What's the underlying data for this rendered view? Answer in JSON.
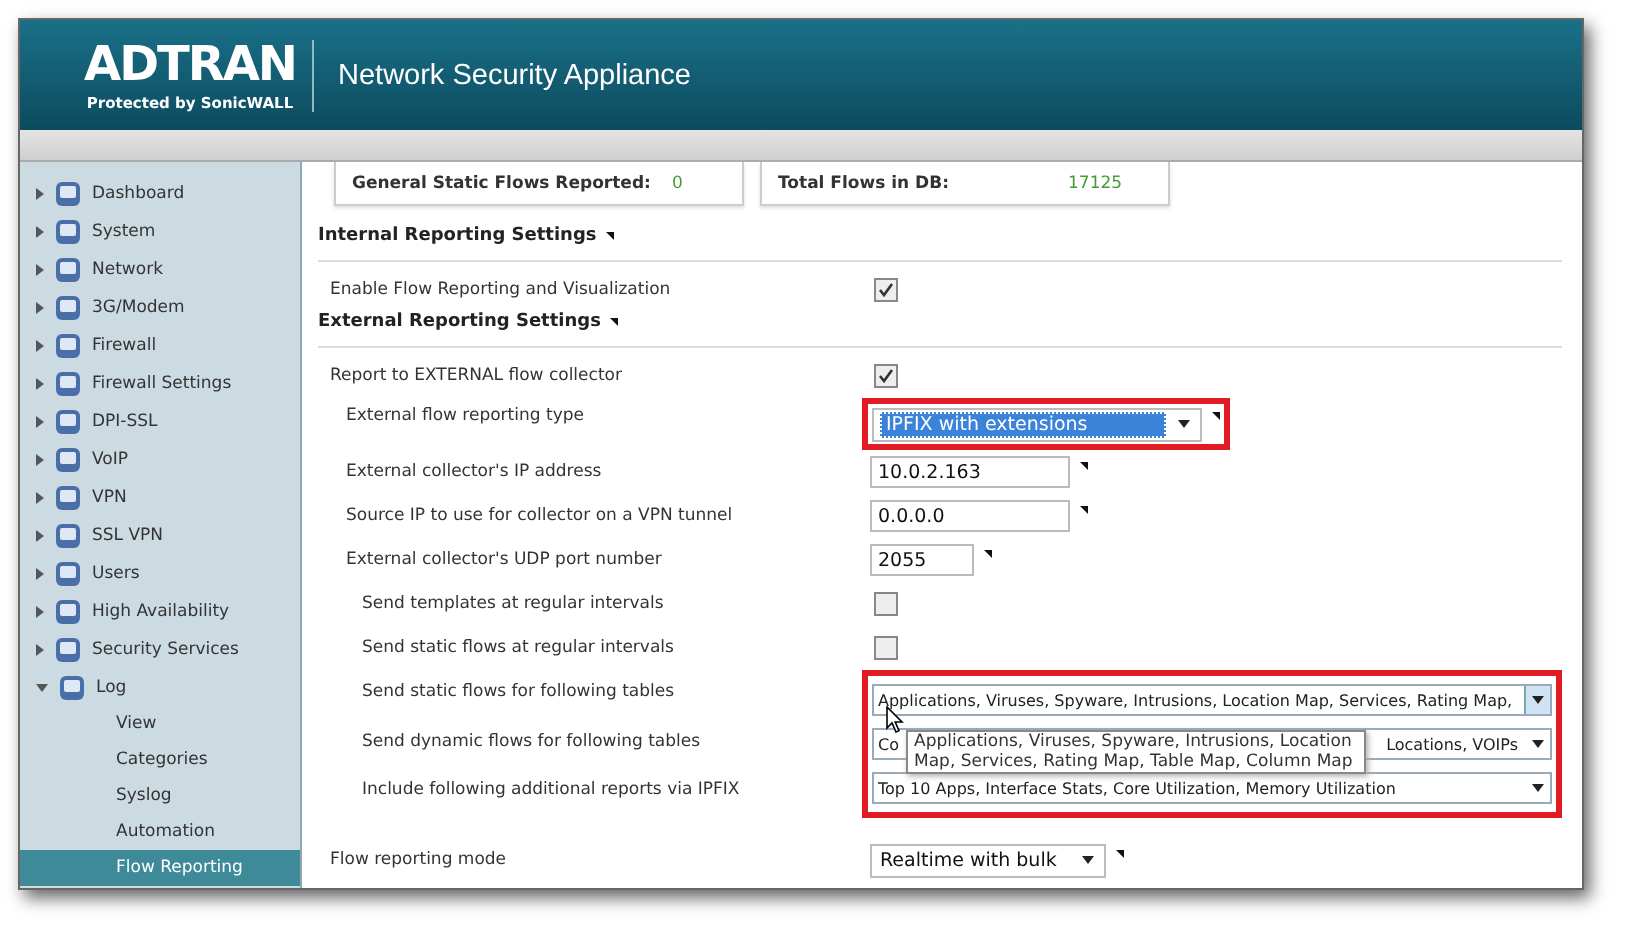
{
  "header": {
    "logo": "ADTRAN",
    "logo_tagline": "Protected by SonicWALL",
    "title": "Network Security Appliance"
  },
  "sidebar": {
    "items": [
      {
        "label": "Dashboard",
        "expanded": false
      },
      {
        "label": "System",
        "expanded": false
      },
      {
        "label": "Network",
        "expanded": false
      },
      {
        "label": "3G/Modem",
        "expanded": false
      },
      {
        "label": "Firewall",
        "expanded": false
      },
      {
        "label": "Firewall Settings",
        "expanded": false
      },
      {
        "label": "DPI-SSL",
        "expanded": false
      },
      {
        "label": "VoIP",
        "expanded": false
      },
      {
        "label": "VPN",
        "expanded": false
      },
      {
        "label": "SSL VPN",
        "expanded": false
      },
      {
        "label": "Users",
        "expanded": false
      },
      {
        "label": "High Availability",
        "expanded": false
      },
      {
        "label": "Security Services",
        "expanded": false
      },
      {
        "label": "Log",
        "expanded": true,
        "children": [
          {
            "label": "View",
            "selected": false
          },
          {
            "label": "Categories",
            "selected": false
          },
          {
            "label": "Syslog",
            "selected": false
          },
          {
            "label": "Automation",
            "selected": false
          },
          {
            "label": "Flow Reporting",
            "selected": true
          }
        ]
      }
    ]
  },
  "stats": [
    {
      "label": "General Static Flows Reported:",
      "value": "0"
    },
    {
      "label": "Total Flows in DB:",
      "value": "17125"
    }
  ],
  "sections": [
    {
      "title": "Internal Reporting Settings",
      "rows": [
        {
          "kind": "checkbox",
          "label": "Enable Flow Reporting and Visualization",
          "checked": true,
          "highlighted": false
        }
      ]
    },
    {
      "title": "External Reporting Settings",
      "rows": [
        {
          "kind": "checkbox",
          "label": "Report to EXTERNAL flow collector",
          "checked": true,
          "highlighted": false,
          "children": [
            {
              "kind": "select",
              "label": "External flow reporting type",
              "value": "IPFIX with extensions",
              "focused": true,
              "highlighted": true
            },
            {
              "kind": "text",
              "label": "External collector's IP address",
              "value": "10.0.2.163",
              "highlighted": false
            },
            {
              "kind": "text",
              "label": "Source IP to use for collector on a VPN tunnel",
              "value": "0.0.0.0",
              "highlighted": false
            },
            {
              "kind": "port",
              "label": "External collector's UDP port number",
              "value": "2055",
              "highlighted": false,
              "children": [
                {
                  "kind": "checkbox",
                  "label": "Send templates at regular intervals",
                  "checked": false,
                  "highlighted": false
                },
                {
                  "kind": "checkbox",
                  "label": "Send static flows at regular intervals",
                  "checked": false,
                  "highlighted": false
                },
                {
                  "kind": "multiselect",
                  "label": "Send static flows for following tables",
                  "value": "Applications, Viruses, Spyware, Intrusions, Location Map, Services, Rating Map,",
                  "hovered": true,
                  "highlighted": true
                },
                {
                  "kind": "multiselect",
                  "label": "Send dynamic flows for following tables",
                  "value": "Co",
                  "value_end": "Locations, VOIPs",
                  "hovered": false,
                  "highlighted": true
                },
                {
                  "kind": "multiselect",
                  "label": "Include following additional reports via IPFIX",
                  "value": "Top 10 Apps, Interface Stats, Core Utilization, Memory Utilization",
                  "hovered": false,
                  "highlighted": true
                }
              ]
            }
          ]
        }
      ]
    },
    {
      "rows": [
        {
          "kind": "select",
          "label": "Flow reporting mode",
          "value": "Realtime with bulk",
          "focused": false,
          "highlighted": false
        }
      ]
    }
  ],
  "tooltip": {
    "text": "Applications, Viruses, Spyware, Intrusions, Location Map, Services, Rating Map, Table Map, Column Map"
  }
}
